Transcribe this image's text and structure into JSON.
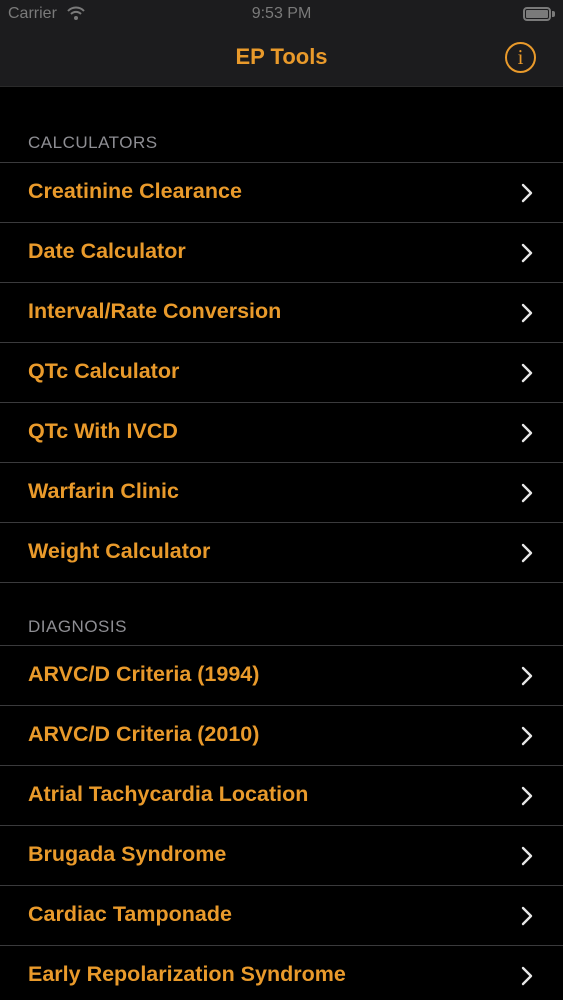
{
  "status_bar": {
    "carrier": "Carrier",
    "time": "9:53 PM"
  },
  "nav": {
    "title": "EP Tools",
    "info_icon": "info-circle-icon",
    "info_glyph": "i"
  },
  "sections": [
    {
      "header": "CALCULATORS",
      "items": [
        {
          "label": "Creatinine Clearance"
        },
        {
          "label": "Date Calculator"
        },
        {
          "label": "Interval/Rate Conversion"
        },
        {
          "label": "QTc Calculator"
        },
        {
          "label": "QTc With IVCD"
        },
        {
          "label": "Warfarin Clinic"
        },
        {
          "label": "Weight Calculator"
        }
      ]
    },
    {
      "header": "DIAGNOSIS",
      "items": [
        {
          "label": "ARVC/D Criteria (1994)"
        },
        {
          "label": "ARVC/D Criteria (2010)"
        },
        {
          "label": "Atrial Tachycardia Location"
        },
        {
          "label": "Brugada Syndrome"
        },
        {
          "label": "Cardiac Tamponade"
        },
        {
          "label": "Early Repolarization Syndrome"
        }
      ]
    }
  ],
  "colors": {
    "accent": "#e99a2b",
    "background": "#000000",
    "bar": "#1c1c1e",
    "separator": "#3a3a3c",
    "section_header": "#8e8e93"
  }
}
